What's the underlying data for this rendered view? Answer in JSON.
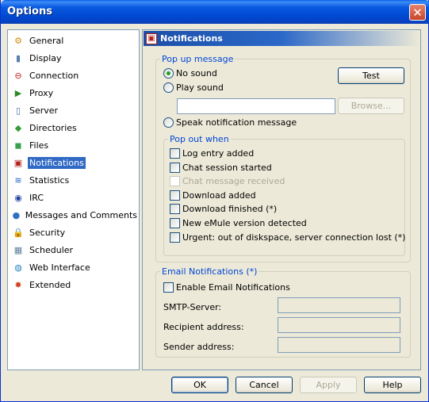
{
  "window": {
    "title": "Options",
    "close_glyph": "✕"
  },
  "nav": {
    "items": [
      {
        "label": "General",
        "icon": "general-icon",
        "glyph": "⚙",
        "color": "#d08a10"
      },
      {
        "label": "Display",
        "icon": "display-icon",
        "glyph": "▮",
        "color": "#5a7fb0"
      },
      {
        "label": "Connection",
        "icon": "connection-icon",
        "glyph": "⊖",
        "color": "#c02020"
      },
      {
        "label": "Proxy",
        "icon": "proxy-icon",
        "glyph": "▶",
        "color": "#2a8a2a"
      },
      {
        "label": "Server",
        "icon": "server-icon",
        "glyph": "▯",
        "color": "#4a6aa0"
      },
      {
        "label": "Directories",
        "icon": "directories-icon",
        "glyph": "◆",
        "color": "#3a9a3a"
      },
      {
        "label": "Files",
        "icon": "files-icon",
        "glyph": "◼",
        "color": "#3aa050"
      },
      {
        "label": "Notifications",
        "icon": "notifications-icon",
        "glyph": "▣",
        "color": "#b02020"
      },
      {
        "label": "Statistics",
        "icon": "statistics-icon",
        "glyph": "≋",
        "color": "#2060c0"
      },
      {
        "label": "IRC",
        "icon": "irc-icon",
        "glyph": "◉",
        "color": "#2040a0"
      },
      {
        "label": "Messages and Comments",
        "icon": "messages-icon",
        "glyph": "●",
        "color": "#3070c0"
      },
      {
        "label": "Security",
        "icon": "security-icon",
        "glyph": "🔒",
        "color": "#c09020"
      },
      {
        "label": "Scheduler",
        "icon": "scheduler-icon",
        "glyph": "▦",
        "color": "#6080a0"
      },
      {
        "label": "Web Interface",
        "icon": "web-interface-icon",
        "glyph": "◍",
        "color": "#2a80c0"
      },
      {
        "label": "Extended",
        "icon": "extended-icon",
        "glyph": "✸",
        "color": "#d04020"
      }
    ],
    "selected_index": 7
  },
  "panel": {
    "title": "Notifications",
    "popup_group": {
      "legend": "Pop up message",
      "no_sound": "No sound",
      "play_sound": "Play sound",
      "test_button": "Test",
      "sound_path_value": "",
      "browse_button": "Browse...",
      "speak": "Speak notification message",
      "selected": "no_sound"
    },
    "popout_group": {
      "legend": "Pop out when",
      "items": [
        {
          "label": "Log entry added",
          "checked": false,
          "enabled": true
        },
        {
          "label": "Chat session started",
          "checked": false,
          "enabled": true
        },
        {
          "label": "Chat message received",
          "checked": false,
          "enabled": false
        },
        {
          "label": "Download added",
          "checked": false,
          "enabled": true
        },
        {
          "label": "Download finished (*)",
          "checked": false,
          "enabled": true
        },
        {
          "label": "New eMule version detected",
          "checked": false,
          "enabled": true
        },
        {
          "label": "Urgent: out of diskspace, server connection lost (*)",
          "checked": false,
          "enabled": true
        }
      ]
    },
    "email_group": {
      "legend": "Email Notifications (*)",
      "enable_label": "Enable Email Notifications",
      "enable_checked": false,
      "smtp_label": "SMTP-Server:",
      "smtp_value": "",
      "recipient_label": "Recipient address:",
      "recipient_value": "",
      "sender_label": "Sender address:",
      "sender_value": ""
    }
  },
  "footer": {
    "ok": "OK",
    "cancel": "Cancel",
    "apply": "Apply",
    "help": "Help"
  },
  "colors": {
    "title_bar": "#0a5ae0",
    "selection": "#316ac5",
    "legend_text": "#0046d5",
    "close_button": "#c8452a"
  }
}
